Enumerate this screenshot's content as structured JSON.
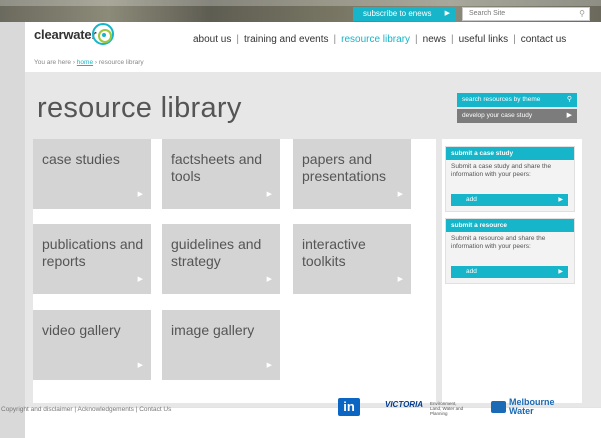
{
  "topbar": {
    "subscribe_label": "subscribe to enews",
    "subscribe_icon": "chevron-right-icon",
    "search_placeholder": "Search Site",
    "search_icon": "search-icon"
  },
  "brand": {
    "name": "clearwater",
    "accent_color": "#16b5c9",
    "secondary_color": "#9cc83b"
  },
  "nav": {
    "items": [
      {
        "label": "about us",
        "active": false
      },
      {
        "label": "training and events",
        "active": false
      },
      {
        "label": "resource library",
        "active": true
      },
      {
        "label": "news",
        "active": false
      },
      {
        "label": "useful links",
        "active": false
      },
      {
        "label": "contact us",
        "active": false
      }
    ],
    "separator": "|"
  },
  "breadcrumb": {
    "prefix": "You are here",
    "sep": "›",
    "home": "home",
    "current": "resource library"
  },
  "page": {
    "title": "resource library",
    "search_theme_label": "search resources by theme",
    "develop_label": "develop your case study"
  },
  "tiles": [
    {
      "label": "case studies"
    },
    {
      "label": "factsheets and tools"
    },
    {
      "label": "papers and presentations"
    },
    {
      "label": "publications and reports"
    },
    {
      "label": "guidelines and strategy"
    },
    {
      "label": "interactive toolkits"
    },
    {
      "label": "video gallery"
    },
    {
      "label": "image gallery"
    }
  ],
  "sidebar": {
    "case_study": {
      "title": "submit a case study",
      "text": "Submit a case study and share the information with your peers:",
      "button": "add"
    },
    "resource": {
      "title": "submit a resource",
      "text": "Submit a resource and share the information with your peers:",
      "button": "add"
    }
  },
  "footer": {
    "copyright": "Copyright and disclaimer",
    "ack": "Acknowledgements",
    "contact": "Contact Us",
    "sep": "|"
  },
  "logos": {
    "linkedin": "in",
    "victoria": "VICTORIA",
    "victoria_sub": "Environment, Land, Water and Planning",
    "mw_line1": "Melbourne",
    "mw_line2": "Water"
  }
}
